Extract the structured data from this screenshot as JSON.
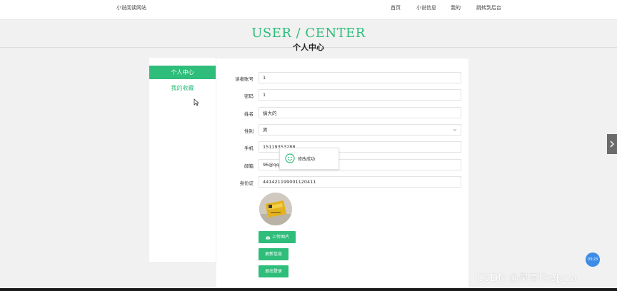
{
  "header": {
    "site_name": "小说阅读网站",
    "nav": [
      "首页",
      "小说信息",
      "我的",
      "跳转到后台"
    ]
  },
  "hero": {
    "title_en": "USER / CENTER",
    "title_cn": "个人中心"
  },
  "sidebar": {
    "items": [
      {
        "label": "个人中心",
        "active": true
      },
      {
        "label": "我的收藏",
        "active": false
      }
    ]
  },
  "form": {
    "fields": [
      {
        "label": "读者账号",
        "value": "1"
      },
      {
        "label": "密码",
        "value": "1"
      },
      {
        "label": "姓名",
        "value": "搞大的"
      },
      {
        "label": "性别",
        "value": "男"
      },
      {
        "label": "手机",
        "value": "15119353288"
      },
      {
        "label": "邮箱",
        "value": "96@qq.com"
      },
      {
        "label": "身份证",
        "value": "441421199001120411"
      }
    ],
    "upload_button": "上传图片",
    "update_button": "更新信息",
    "logout_button": "退出登录"
  },
  "toast": {
    "message": "修改成功"
  },
  "floating_badge": "03:23",
  "watermark": "CSDN @昊言likeJava",
  "colors": {
    "accent": "#2ebd7a",
    "page_bg": "#f1f1f1"
  }
}
